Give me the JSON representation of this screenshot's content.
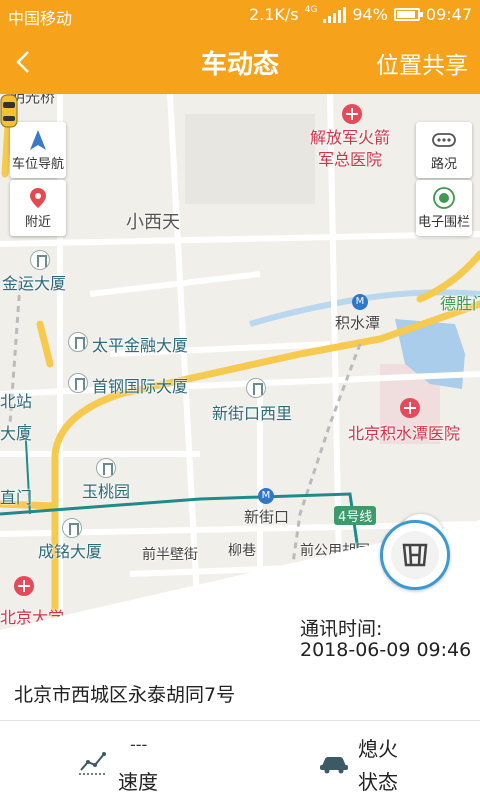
{
  "status_bar": {
    "carrier": "中国移动",
    "net_speed": "2.1K/s",
    "network": "4G",
    "battery": "94%",
    "time": "09:47"
  },
  "header": {
    "title": "车动态",
    "share_label": "位置共享"
  },
  "map": {
    "controls": {
      "navigation_label": "车位导航",
      "nearby_label": "附近",
      "traffic_label": "路况",
      "geofence_label": "电子围栏"
    },
    "labels": {
      "top_cut": "明光桥",
      "hospital_1_line1": "解放军火箭",
      "hospital_1_line2": "军总医院",
      "xiaoxitian": "小西天",
      "jinyun": "金运大厦",
      "deshengmen": "德胜门",
      "jishuitan": "积水潭",
      "taiping": "太平金融大厦",
      "shougang": "首钢国际大厦",
      "beizhan": "北站",
      "da_sha": "大厦",
      "xinjiekou_xili": "新街口西里",
      "hospital_2": "北京积水潭医院",
      "yutaoyuan": "玉桃园",
      "zhimen": "直门",
      "xinjiekou": "新街口",
      "line4": "4号线",
      "chengming": "成铭大厦",
      "qianbanbi": "前半壁街",
      "liuxiang": "柳巷",
      "qiangonghong": "前公用胡同",
      "university": "北京大学"
    }
  },
  "info": {
    "comm_label": "通讯时间:",
    "comm_time": "2018-06-09 09:46",
    "address": "北京市西城区永泰胡同7号",
    "speed_value": "---",
    "speed_label": "速度",
    "state_value": "熄火",
    "state_label": "状态"
  },
  "colors": {
    "accent": "#f6a31b",
    "locate_blue": "#2c7ed8",
    "honda_ring": "#3c9ad0",
    "subway_line": "#1e8a8c"
  }
}
